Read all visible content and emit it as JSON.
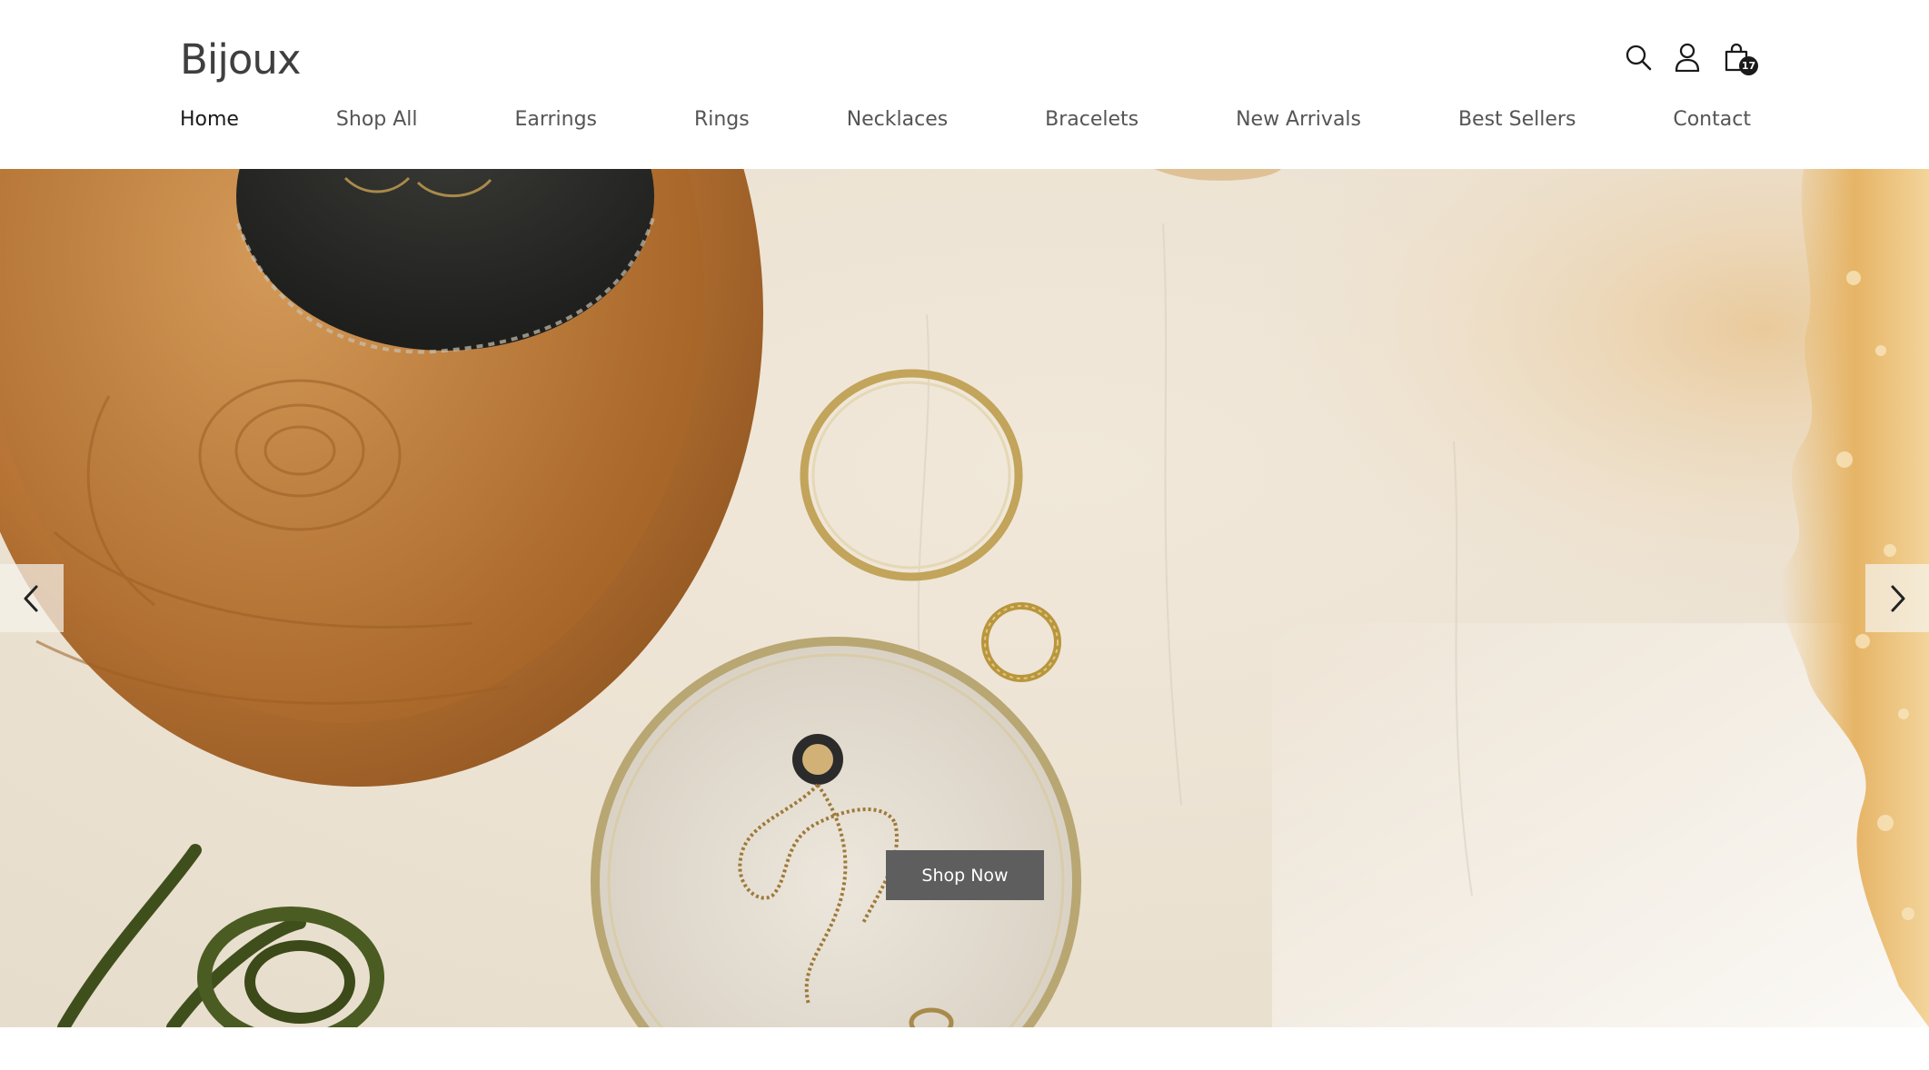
{
  "brand": {
    "logo_text": "Bijoux"
  },
  "header": {
    "icons": [
      {
        "name": "search-icon"
      },
      {
        "name": "account-icon"
      },
      {
        "name": "cart-icon"
      }
    ],
    "cart_count": "17"
  },
  "nav": {
    "items": [
      {
        "label": "Home",
        "active": true
      },
      {
        "label": "Shop All"
      },
      {
        "label": "Earrings"
      },
      {
        "label": "Rings"
      },
      {
        "label": "Necklaces"
      },
      {
        "label": "Bracelets"
      },
      {
        "label": "New Arrivals"
      },
      {
        "label": "Best Sellers"
      },
      {
        "label": "Contact"
      }
    ]
  },
  "hero": {
    "cta_label": "Shop Now",
    "prev_icon": "chevron-left-icon",
    "next_icon": "chevron-right-icon"
  },
  "colors": {
    "text_dark": "#1a1a1a",
    "nav_text": "#555555",
    "cta_bg": "#5e5e5e",
    "surface": "#efe6d8",
    "wood": "#c98a47",
    "gold": "#b89a52"
  }
}
